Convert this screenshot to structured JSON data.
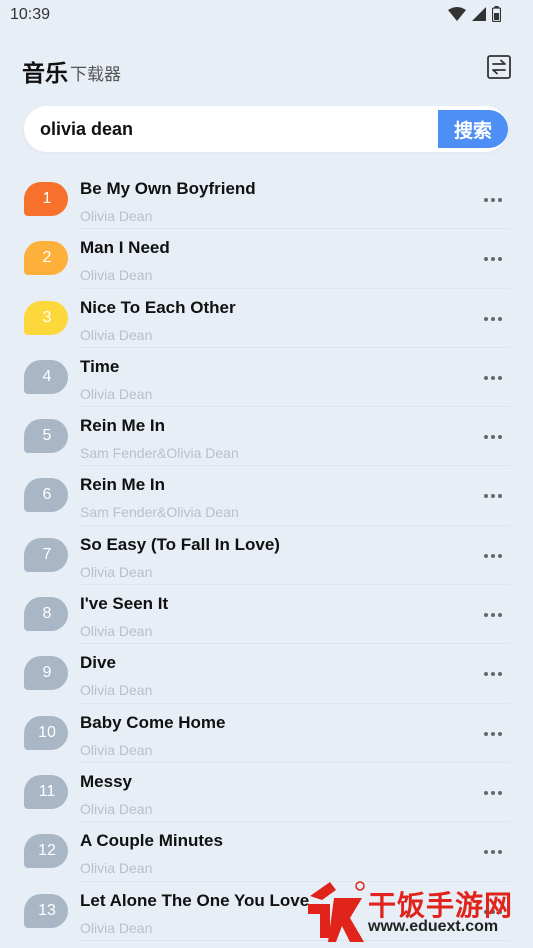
{
  "status_bar": {
    "time": "10:39"
  },
  "header": {
    "title": "音乐",
    "subtitle": "下载器"
  },
  "search": {
    "value": "olivia dean",
    "button_label": "搜索"
  },
  "colors": {
    "accent": "#4d8ff5",
    "rank_1": "#f7712c",
    "rank_2": "#fdb13a",
    "rank_3": "#fdd83a",
    "rank_other": "#a9b6c6"
  },
  "songs": [
    {
      "rank": "1",
      "title": "Be My Own Boyfriend",
      "artist": "Olivia Dean"
    },
    {
      "rank": "2",
      "title": "Man I Need",
      "artist": "Olivia Dean"
    },
    {
      "rank": "3",
      "title": "Nice To Each Other",
      "artist": "Olivia Dean"
    },
    {
      "rank": "4",
      "title": "Time",
      "artist": "Olivia Dean"
    },
    {
      "rank": "5",
      "title": "Rein Me In",
      "artist": "Sam Fender&Olivia Dean"
    },
    {
      "rank": "6",
      "title": "Rein Me In",
      "artist": "Sam Fender&Olivia Dean"
    },
    {
      "rank": "7",
      "title": "So Easy (To Fall In Love)",
      "artist": "Olivia Dean"
    },
    {
      "rank": "8",
      "title": "I've Seen It",
      "artist": "Olivia Dean"
    },
    {
      "rank": "9",
      "title": "Dive",
      "artist": "Olivia Dean"
    },
    {
      "rank": "10",
      "title": "Baby Come Home",
      "artist": "Olivia Dean"
    },
    {
      "rank": "11",
      "title": "Messy",
      "artist": "Olivia Dean"
    },
    {
      "rank": "12",
      "title": "A Couple Minutes",
      "artist": "Olivia Dean"
    },
    {
      "rank": "13",
      "title": "Let Alone The One You Love",
      "artist": "Olivia Dean"
    }
  ],
  "watermark": {
    "text": "干饭手游网",
    "url": "www.eduext.com"
  }
}
